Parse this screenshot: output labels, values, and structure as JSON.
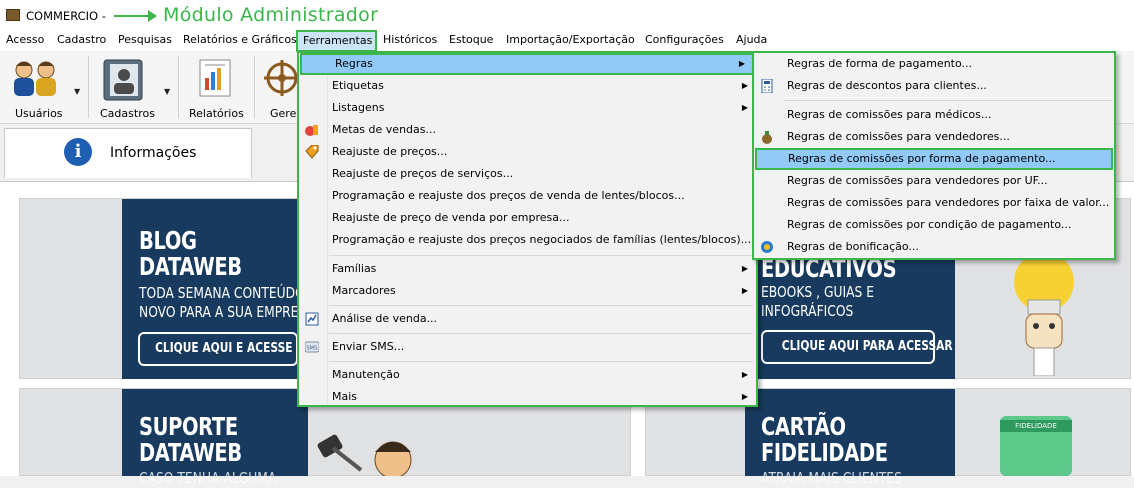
{
  "window": {
    "title": "COMMERCIO -",
    "annotation": "Módulo Administrador"
  },
  "menubar": [
    "Acesso",
    "Cadastro",
    "Pesquisas",
    "Relatórios e Gráficos",
    "Ferramentas",
    "Históricos",
    "Estoque",
    "Importação/Exportação",
    "Configurações",
    "Ajuda"
  ],
  "toolbar": {
    "usuarios": "Usuários",
    "cadastros": "Cadastros",
    "relatorios": "Relatórios",
    "gerencial": "Gere"
  },
  "tab": {
    "informacoes": "Informações",
    "info_icon": "i"
  },
  "banners": {
    "blog_title": "BLOG\nDATAWEB",
    "blog_text": "TODA SEMANA CONTEÚDO\nNOVO PARA A SUA EMPRESA",
    "blog_button": "CLIQUE AQUI E ACESSE",
    "edu_title": "EDUCATIVOS",
    "edu_text": "EBOOKS , GUIAS E\nINFOGRÁFICOS",
    "edu_button": "CLIQUE AQUI PARA ACESSAR",
    "suporte_title": "SUPORTE\nDATAWEB",
    "suporte_text": "CASO TENHA ALGUMA",
    "cartao_title": "CARTÃO\nFIDELIDADE",
    "cartao_text": "ATRAIA MAIS CLIENTES",
    "cartao_card_label": "FIDELIDADE"
  },
  "ferramentas_menu": [
    {
      "label": "Regras",
      "submenu": true
    },
    {
      "label": "Etiquetas",
      "submenu": true
    },
    {
      "label": "Listagens",
      "submenu": true
    },
    {
      "label": "Metas de vendas...",
      "submenu": false
    },
    {
      "label": "Reajuste de preços...",
      "submenu": false
    },
    {
      "label": "Reajuste de preços de serviços...",
      "submenu": false
    },
    {
      "label": "Programação e reajuste dos preços de venda de lentes/blocos...",
      "submenu": false
    },
    {
      "label": "Reajuste de preço de venda por empresa...",
      "submenu": false
    },
    {
      "label": "Programação e reajuste dos preços negociados de famílias (lentes/blocos)...",
      "submenu": false
    },
    {
      "label": "Famílias",
      "submenu": true
    },
    {
      "label": "Marcadores",
      "submenu": true
    },
    {
      "label": "Análise de venda...",
      "submenu": false
    },
    {
      "label": "Enviar SMS...",
      "submenu": false
    },
    {
      "label": "Manutenção",
      "submenu": true
    },
    {
      "label": "Mais",
      "submenu": true
    }
  ],
  "regras_menu": [
    "Regras de forma de pagamento...",
    "Regras de descontos para clientes...",
    "Regras de comissões para médicos...",
    "Regras de comissões para vendedores...",
    "Regras de comissões por forma de pagamento...",
    "Regras de comissões para vendedores por UF...",
    "Regras de comissões para vendedores por faixa de valor...",
    "Regras de comissões por condição de pagamento...",
    "Regras de bonificação..."
  ],
  "submenu_arrow": "▶",
  "colors": {
    "accent_green": "#3cb64a",
    "highlight": "#91c9f7",
    "navy": "#173a5e"
  }
}
